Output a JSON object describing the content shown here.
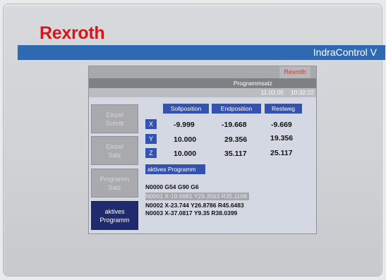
{
  "brand": "Rexroth",
  "product": "IndraControl V",
  "screen": {
    "header_tab": "Rexroth",
    "mode_label": "Programmsatz",
    "date": "11.02.05",
    "time": "10:32:22",
    "side_buttons": [
      {
        "line1": "Einzel",
        "line2": "Schritt",
        "active": false
      },
      {
        "line1": "Einzel",
        "line2": "Satz",
        "active": false
      },
      {
        "line1": "Programm",
        "line2": "Satz",
        "active": false
      },
      {
        "line1": "aktives",
        "line2": "Programm",
        "active": true
      }
    ],
    "columns": [
      "Sollposition",
      "Endposition",
      "Restweg"
    ],
    "axes": [
      {
        "name": "X",
        "soll": "-9.999",
        "end": "-19.668",
        "rest": "-9.669"
      },
      {
        "name": "Y",
        "soll": "10.000",
        "end": "29.356",
        "rest": "19.356"
      },
      {
        "name": "Z",
        "soll": "10.000",
        "end": "35.117",
        "rest": "25.117"
      }
    ],
    "program_label": "aktives Programm",
    "program_lines": [
      "N0000 G54 G90 G6",
      "N0001 X-19.6681 Y29.3563 R35.1168",
      "N0002 X-23.744 Y26.8786 R45.6483",
      "N0003 X-37.0817 Y9.35 R38.0399"
    ],
    "current_line_index": 1
  }
}
